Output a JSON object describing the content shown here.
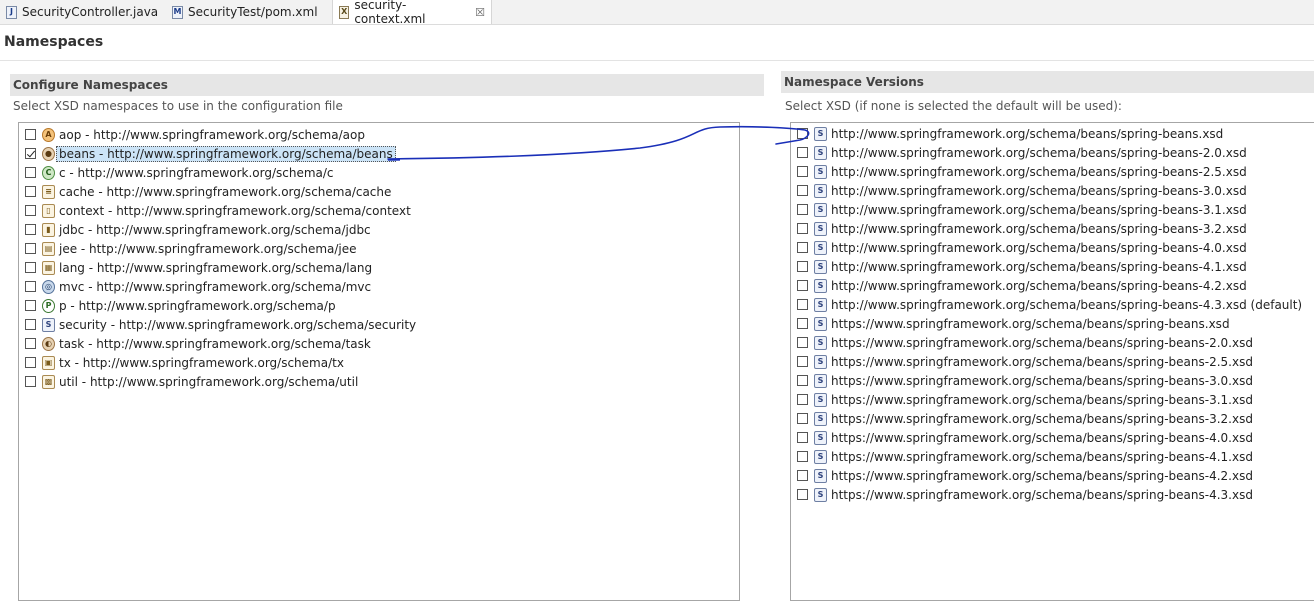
{
  "tabs": [
    {
      "label": "SecurityController.java",
      "icon": "J",
      "active": false
    },
    {
      "label": "SecurityTest/pom.xml",
      "icon": "M",
      "active": false
    },
    {
      "label": "security-context.xml",
      "icon": "X",
      "active": true
    }
  ],
  "tab_close_glyph": "☒",
  "page_title": "Namespaces",
  "configure": {
    "header": "Configure Namespaces",
    "description": "Select XSD namespaces to use in the configuration file",
    "items": [
      {
        "label": "aop - http://www.springframework.org/schema/aop",
        "icon": "orange",
        "glyph": "A",
        "checked": false
      },
      {
        "label": "beans - http://www.springframework.org/schema/beans",
        "icon": "bean",
        "glyph": "●",
        "checked": true
      },
      {
        "label": "c - http://www.springframework.org/schema/c",
        "icon": "green",
        "glyph": "C",
        "checked": false
      },
      {
        "label": "cache - http://www.springframework.org/schema/cache",
        "icon": "doc",
        "glyph": "≡",
        "checked": false
      },
      {
        "label": "context - http://www.springframework.org/schema/context",
        "icon": "doc",
        "glyph": "▯",
        "checked": false
      },
      {
        "label": "jdbc - http://www.springframework.org/schema/jdbc",
        "icon": "doc",
        "glyph": "▮",
        "checked": false
      },
      {
        "label": "jee - http://www.springframework.org/schema/jee",
        "icon": "doc",
        "glyph": "▤",
        "checked": false
      },
      {
        "label": "lang - http://www.springframework.org/schema/lang",
        "icon": "doc",
        "glyph": "▦",
        "checked": false
      },
      {
        "label": "mvc - http://www.springframework.org/schema/mvc",
        "icon": "globe",
        "glyph": "◎",
        "checked": false
      },
      {
        "label": "p - http://www.springframework.org/schema/p",
        "icon": "p",
        "glyph": "P",
        "checked": false
      },
      {
        "label": "security - http://www.springframework.org/schema/security",
        "icon": "s",
        "glyph": "S",
        "checked": false
      },
      {
        "label": "task - http://www.springframework.org/schema/task",
        "icon": "bean",
        "glyph": "◐",
        "checked": false
      },
      {
        "label": "tx - http://www.springframework.org/schema/tx",
        "icon": "doc",
        "glyph": "▣",
        "checked": false
      },
      {
        "label": "util - http://www.springframework.org/schema/util",
        "icon": "doc",
        "glyph": "▩",
        "checked": false
      }
    ]
  },
  "versions": {
    "header": "Namespace Versions",
    "description": "Select XSD (if none is selected the default will be used):",
    "items": [
      {
        "label": "http://www.springframework.org/schema/beans/spring-beans.xsd",
        "checked": false
      },
      {
        "label": "http://www.springframework.org/schema/beans/spring-beans-2.0.xsd",
        "checked": false
      },
      {
        "label": "http://www.springframework.org/schema/beans/spring-beans-2.5.xsd",
        "checked": false
      },
      {
        "label": "http://www.springframework.org/schema/beans/spring-beans-3.0.xsd",
        "checked": false
      },
      {
        "label": "http://www.springframework.org/schema/beans/spring-beans-3.1.xsd",
        "checked": false
      },
      {
        "label": "http://www.springframework.org/schema/beans/spring-beans-3.2.xsd",
        "checked": false
      },
      {
        "label": "http://www.springframework.org/schema/beans/spring-beans-4.0.xsd",
        "checked": false
      },
      {
        "label": "http://www.springframework.org/schema/beans/spring-beans-4.1.xsd",
        "checked": false
      },
      {
        "label": "http://www.springframework.org/schema/beans/spring-beans-4.2.xsd",
        "checked": false
      },
      {
        "label": "http://www.springframework.org/schema/beans/spring-beans-4.3.xsd (default)",
        "checked": false
      },
      {
        "label": "https://www.springframework.org/schema/beans/spring-beans.xsd",
        "checked": false
      },
      {
        "label": "https://www.springframework.org/schema/beans/spring-beans-2.0.xsd",
        "checked": false
      },
      {
        "label": "https://www.springframework.org/schema/beans/spring-beans-2.5.xsd",
        "checked": false
      },
      {
        "label": "https://www.springframework.org/schema/beans/spring-beans-3.0.xsd",
        "checked": false
      },
      {
        "label": "https://www.springframework.org/schema/beans/spring-beans-3.1.xsd",
        "checked": false
      },
      {
        "label": "https://www.springframework.org/schema/beans/spring-beans-3.2.xsd",
        "checked": false
      },
      {
        "label": "https://www.springframework.org/schema/beans/spring-beans-4.0.xsd",
        "checked": false
      },
      {
        "label": "https://www.springframework.org/schema/beans/spring-beans-4.1.xsd",
        "checked": false
      },
      {
        "label": "https://www.springframework.org/schema/beans/spring-beans-4.2.xsd",
        "checked": false
      },
      {
        "label": "https://www.springframework.org/schema/beans/spring-beans-4.3.xsd",
        "checked": false
      }
    ],
    "item_icon": "S"
  },
  "colors": {
    "selection": "#cce4f7",
    "annotation_stroke": "#1a2fb8",
    "section_header_bg": "#e6e6e6"
  }
}
